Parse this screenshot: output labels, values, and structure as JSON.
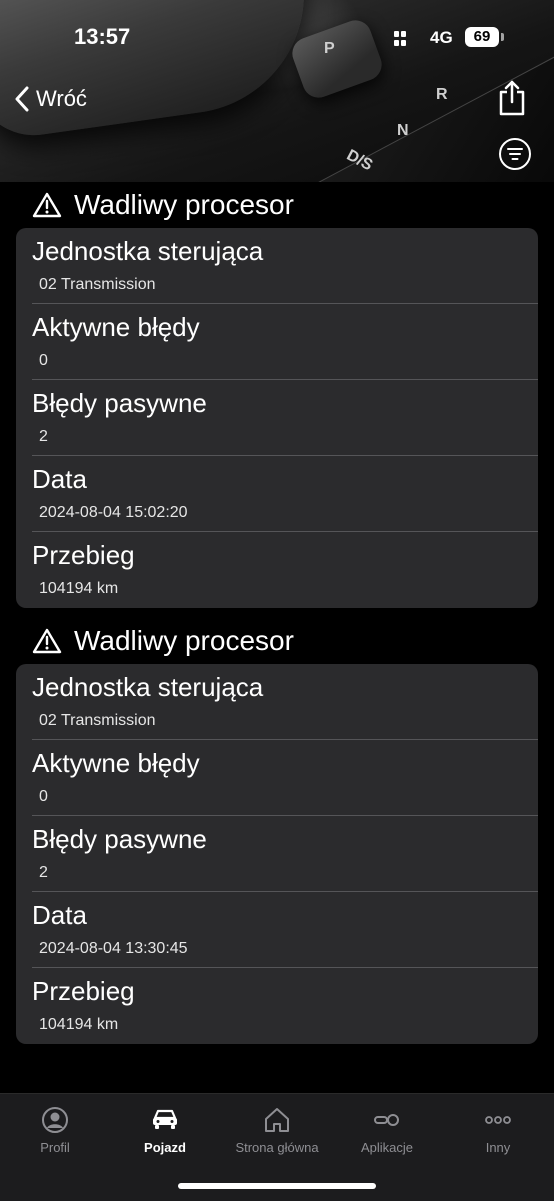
{
  "status_bar": {
    "time": "13:57",
    "network": "4G",
    "battery": "69"
  },
  "nav": {
    "back_label": "Wróć",
    "share_icon": "share-icon",
    "filter_icon": "filter-icon"
  },
  "header_image": {
    "gear_letters": [
      "P",
      "R",
      "N",
      "D/S"
    ]
  },
  "errors": [
    {
      "title": "Wadliwy procesor",
      "rows": [
        {
          "label": "Jednostka sterująca",
          "value": "02 Transmission"
        },
        {
          "label": "Aktywne błędy",
          "value": "0"
        },
        {
          "label": "Błędy pasywne",
          "value": "2"
        },
        {
          "label": "Data",
          "value": "2024-08-04 15:02:20"
        },
        {
          "label": "Przebieg",
          "value": "104194 km"
        }
      ]
    },
    {
      "title": "Wadliwy procesor",
      "rows": [
        {
          "label": "Jednostka sterująca",
          "value": "02 Transmission"
        },
        {
          "label": "Aktywne błędy",
          "value": "0"
        },
        {
          "label": "Błędy pasywne",
          "value": "2"
        },
        {
          "label": "Data",
          "value": "2024-08-04 13:30:45"
        },
        {
          "label": "Przebieg",
          "value": "104194 km"
        }
      ]
    }
  ],
  "tabbar": {
    "tabs": [
      {
        "label": "Profil",
        "icon": "profile-icon",
        "active": false
      },
      {
        "label": "Pojazd",
        "icon": "car-icon",
        "active": true
      },
      {
        "label": "Strona główna",
        "icon": "home-icon",
        "active": false
      },
      {
        "label": "Aplikacje",
        "icon": "apps-icon",
        "active": false
      },
      {
        "label": "Inny",
        "icon": "more-icon",
        "active": false
      }
    ]
  },
  "colors": {
    "background": "#000000",
    "card": "#2b2b2d",
    "tabbar": "#1c1c1e",
    "inactive_tab": "#8e8e93"
  }
}
